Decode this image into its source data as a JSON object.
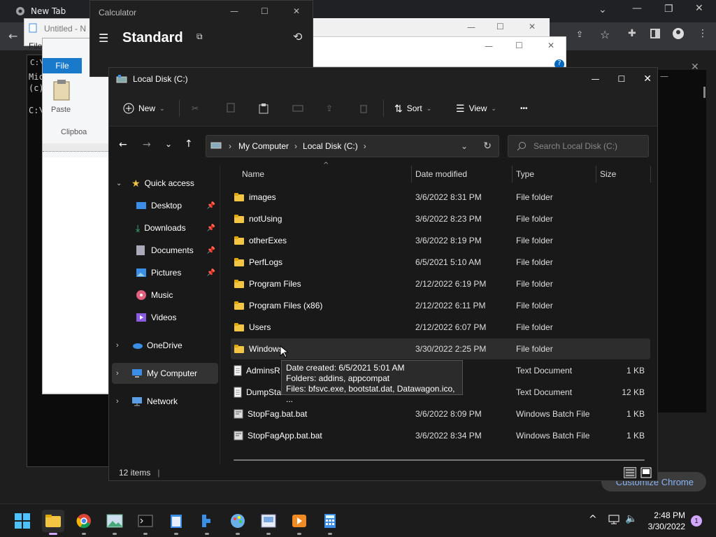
{
  "chrome": {
    "tab_title": "New Tab",
    "customize_label": "Customize Chrome"
  },
  "notepad": {
    "title": "Untitled - N",
    "menu_file": "File"
  },
  "cmd": {
    "lines": [
      "Mic",
      "(c)",
      "",
      "C:\\"
    ]
  },
  "paint": {
    "file_tab": "File",
    "paste_label": "Paste",
    "clipboard_label": "Clipboa"
  },
  "calculator": {
    "title": "Calculator",
    "mode": "Standard"
  },
  "explorer": {
    "title": "Local Disk (C:)",
    "toolbar": {
      "new_label": "New",
      "sort_label": "Sort",
      "view_label": "View",
      "more_label": "•••"
    },
    "address": {
      "crumbs": [
        "My Computer",
        "Local Disk (C:)"
      ]
    },
    "search_placeholder": "Search Local Disk (C:)",
    "nav": {
      "quick_access": "Quick access",
      "items": [
        {
          "label": "Desktop",
          "pinned": true
        },
        {
          "label": "Downloads",
          "pinned": true
        },
        {
          "label": "Documents",
          "pinned": true
        },
        {
          "label": "Pictures",
          "pinned": true
        },
        {
          "label": "Music",
          "pinned": false
        },
        {
          "label": "Videos",
          "pinned": false
        }
      ],
      "onedrive": "OneDrive",
      "my_computer": "My Computer",
      "network": "Network"
    },
    "columns": {
      "name": "Name",
      "date": "Date modified",
      "type": "Type",
      "size": "Size"
    },
    "files": [
      {
        "name": "images",
        "date": "3/6/2022 8:31 PM",
        "type": "File folder",
        "size": "",
        "kind": "folder"
      },
      {
        "name": "notUsing",
        "date": "3/6/2022 8:23 PM",
        "type": "File folder",
        "size": "",
        "kind": "folder"
      },
      {
        "name": "otherExes",
        "date": "3/6/2022 8:19 PM",
        "type": "File folder",
        "size": "",
        "kind": "folder"
      },
      {
        "name": "PerfLogs",
        "date": "6/5/2021 5:10 AM",
        "type": "File folder",
        "size": "",
        "kind": "folder"
      },
      {
        "name": "Program Files",
        "date": "2/12/2022 6:19 PM",
        "type": "File folder",
        "size": "",
        "kind": "folder"
      },
      {
        "name": "Program Files (x86)",
        "date": "2/12/2022 6:11 PM",
        "type": "File folder",
        "size": "",
        "kind": "folder"
      },
      {
        "name": "Users",
        "date": "2/12/2022 6:07 PM",
        "type": "File folder",
        "size": "",
        "kind": "folder"
      },
      {
        "name": "Windows",
        "date": "3/30/2022 2:25 PM",
        "type": "File folder",
        "size": "",
        "kind": "folder"
      },
      {
        "name": "AdminsR",
        "date": "PM",
        "type": "Text Document",
        "size": "1 KB",
        "kind": "doc"
      },
      {
        "name": "DumpSta",
        "date": "1 PM",
        "type": "Text Document",
        "size": "12 KB",
        "kind": "doc"
      },
      {
        "name": "StopFag.bat.bat",
        "date": "3/6/2022 8:09 PM",
        "type": "Windows Batch File",
        "size": "1 KB",
        "kind": "bat"
      },
      {
        "name": "StopFagApp.bat.bat",
        "date": "3/6/2022 8:34 PM",
        "type": "Windows Batch File",
        "size": "1 KB",
        "kind": "bat"
      }
    ],
    "status": "12 items",
    "tooltip": {
      "line1": "Date created: 6/5/2021 5:01 AM",
      "line2": "Folders: addins, appcompat",
      "line3": "Files: bfsvc.exe, bootstat.dat, Datawagon.ico, ..."
    }
  },
  "taskbar": {
    "time": "2:48 PM",
    "date": "3/30/2022",
    "notification_count": "1"
  },
  "colors": {
    "folder": "#f4c542",
    "accent": "#0067c0",
    "selection": "#2d2d2d"
  }
}
